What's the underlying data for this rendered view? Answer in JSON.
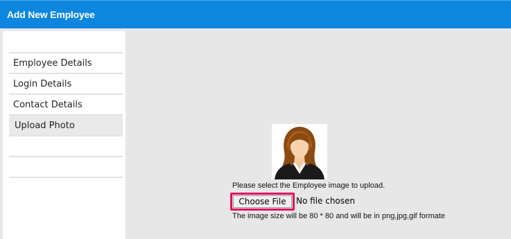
{
  "header": {
    "title": "Add New Employee",
    "color": "#0d86e0"
  },
  "sidebar": {
    "items": [
      {
        "label": "Employee Details",
        "active": false
      },
      {
        "label": "Login Details",
        "active": false
      },
      {
        "label": "Contact Details",
        "active": false
      },
      {
        "label": "Upload Photo",
        "active": true
      }
    ]
  },
  "upload": {
    "placeholder_icon": "female-avatar-icon",
    "instruction": "Please select the Employee image to upload.",
    "choose_button_label": "Choose File",
    "file_status": "No file chosen",
    "size_note": "The image size will be 80 * 80 and will be in png,jpg,gif formate",
    "highlight_color": "#e0115f"
  }
}
